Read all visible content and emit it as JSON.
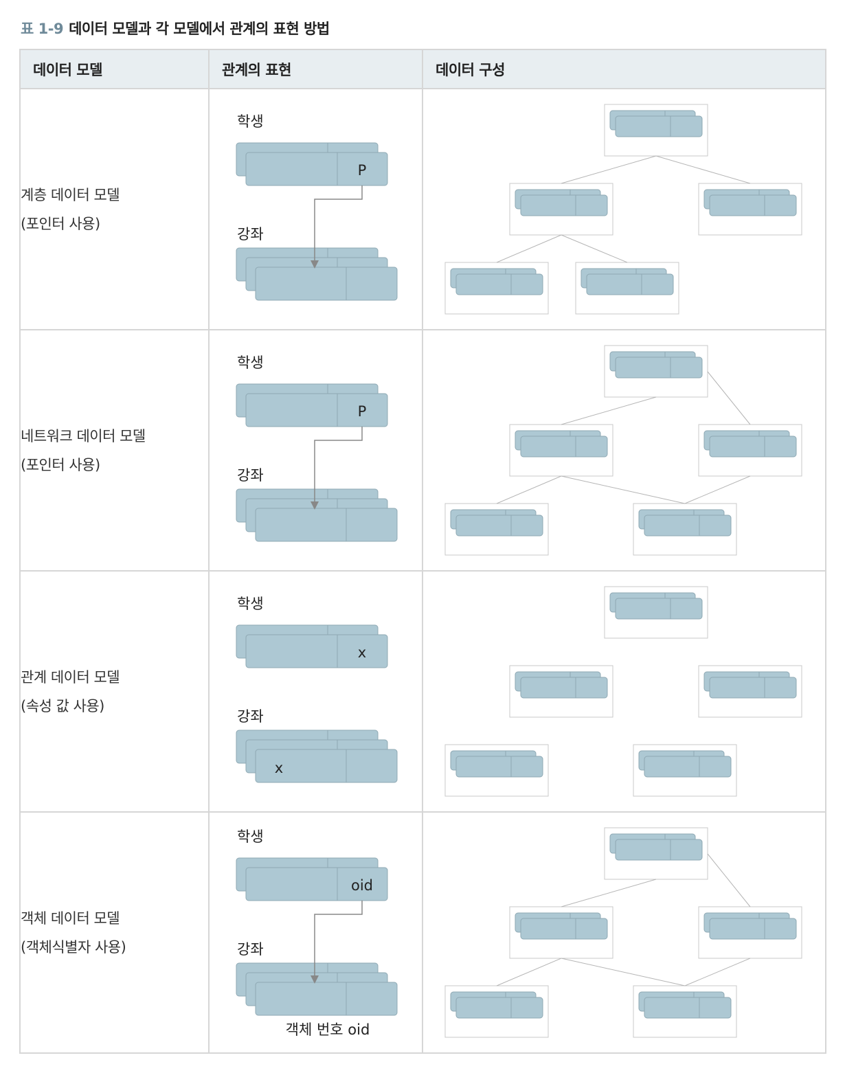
{
  "caption": {
    "number": "표 1-9",
    "title": "데이터 모델과 각 모델에서 관계의 표현 방법"
  },
  "table": {
    "headers": [
      "데이터 모델",
      "관계의 표현",
      "데이터 구성"
    ],
    "rows": [
      {
        "model_line1": "계층 데이터 모델",
        "model_line2": "(포인터 사용)",
        "rep": {
          "parent_label": "학생",
          "child_label": "강좌",
          "parent_field": "P",
          "child_field": "",
          "note": "",
          "arrow": true
        },
        "structure": "hierarchical"
      },
      {
        "model_line1": "네트워크 데이터 모델",
        "model_line2": "(포인터 사용)",
        "rep": {
          "parent_label": "학생",
          "child_label": "강좌",
          "parent_field": "P",
          "child_field": "",
          "note": "",
          "arrow": true
        },
        "structure": "network"
      },
      {
        "model_line1": "관계 데이터 모델",
        "model_line2": "(속성 값 사용)",
        "rep": {
          "parent_label": "학생",
          "child_label": "강좌",
          "parent_field": "x",
          "child_field": "x",
          "note": "",
          "arrow": false
        },
        "structure": "relational"
      },
      {
        "model_line1": "객체 데이터 모델",
        "model_line2": "(객체식별자 사용)",
        "rep": {
          "parent_label": "학생",
          "child_label": "강좌",
          "parent_field": "oid",
          "child_field": "",
          "note": "객체 번호 oid",
          "arrow": true
        },
        "structure": "network"
      }
    ]
  },
  "colors": {
    "record_fill": "#adc8d3",
    "record_stroke": "#8ea8b3",
    "box_stroke": "#c8c8c8",
    "line": "#b5b5b5",
    "arrow": "#888888",
    "header_bg": "#e8eef1"
  }
}
